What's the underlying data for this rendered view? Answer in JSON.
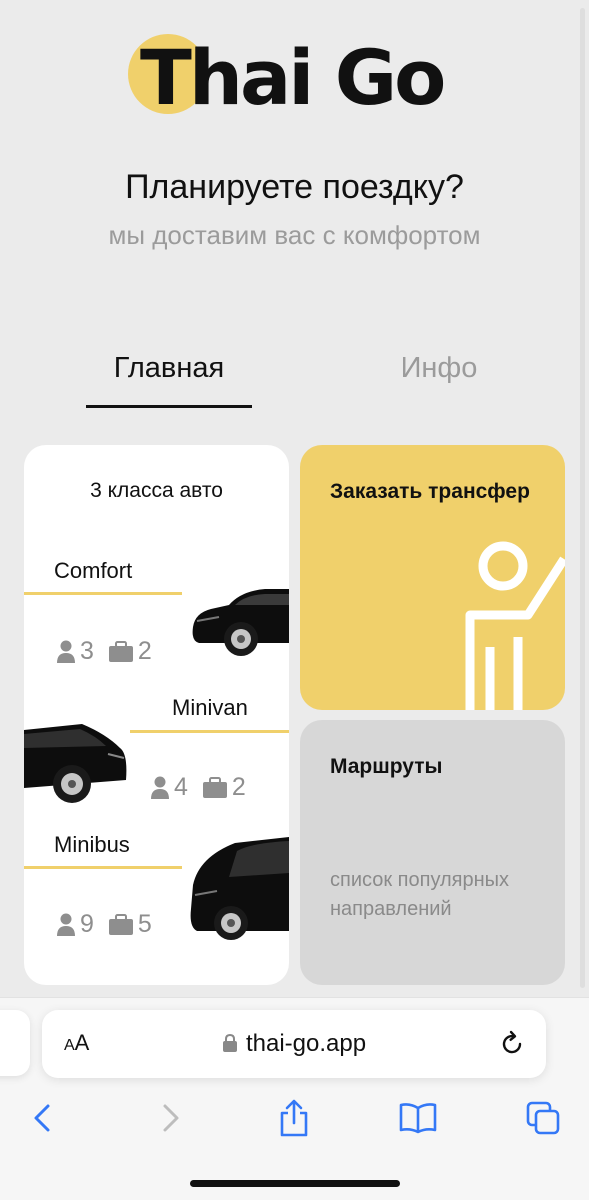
{
  "logo": {
    "text": "Thai Go"
  },
  "hero": {
    "title": "Планируете поездку?",
    "subtitle": "мы доставим вас с комфортом"
  },
  "tabs": [
    {
      "label": "Главная",
      "active": true
    },
    {
      "label": "Инфо",
      "active": false
    }
  ],
  "classes_card": {
    "title": "3 класса авто",
    "cars": [
      {
        "name": "Comfort",
        "passengers": "3",
        "bags": "2"
      },
      {
        "name": "Minivan",
        "passengers": "4",
        "bags": "2"
      },
      {
        "name": "Minibus",
        "passengers": "9",
        "bags": "5"
      }
    ]
  },
  "transfer_card": {
    "title": "Заказать трансфер"
  },
  "routes_card": {
    "title": "Маршруты",
    "description": "список популярных направлений"
  },
  "browser": {
    "aa_label_small": "A",
    "aa_label_large": "A",
    "url": "thai-go.app"
  },
  "colors": {
    "accent": "#f0d06b",
    "background": "#ebebeb",
    "routes_card": "#d7d7d7",
    "muted_text": "#9b9b9b",
    "ios_blue": "#3478f6"
  },
  "icons": [
    "person-icon",
    "suitcase-icon",
    "lock-icon",
    "reload-icon",
    "back-icon",
    "forward-icon",
    "share-icon",
    "bookmarks-icon",
    "tabs-icon"
  ]
}
